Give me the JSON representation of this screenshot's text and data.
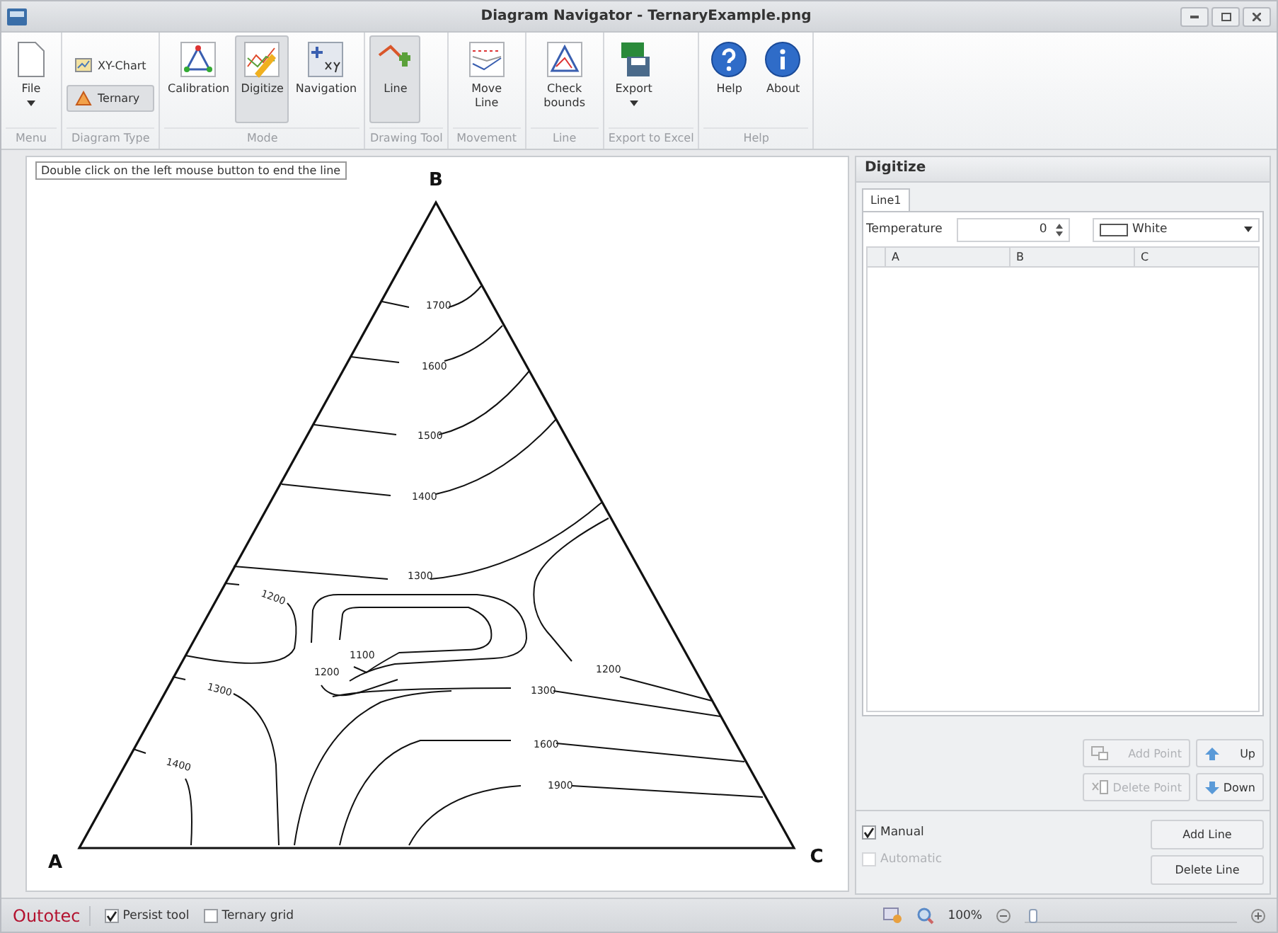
{
  "window": {
    "title": "Diagram Navigator - TernaryExample.png"
  },
  "ribbon": [
    {
      "label": "Menu",
      "kind": "large",
      "buttons": [
        {
          "label": "File",
          "selected": false,
          "dropdown": true
        }
      ]
    },
    {
      "label": "Diagram Type",
      "kind": "small",
      "buttons": [
        {
          "label": "XY-Chart",
          "selected": false
        },
        {
          "label": "Ternary",
          "selected": true
        }
      ]
    },
    {
      "label": "Mode",
      "kind": "large",
      "buttons": [
        {
          "label": "Calibration",
          "selected": false
        },
        {
          "label": "Digitize",
          "selected": true
        },
        {
          "label": "Navigation",
          "selected": false
        }
      ]
    },
    {
      "label": "Drawing Tool",
      "kind": "large",
      "buttons": [
        {
          "label": "Line",
          "selected": true
        }
      ]
    },
    {
      "label": "Movement",
      "kind": "large",
      "buttons": [
        {
          "label": "Move Line",
          "selected": false
        }
      ]
    },
    {
      "label": "Line",
      "kind": "large",
      "buttons": [
        {
          "label": "Check bounds",
          "selected": false
        }
      ]
    },
    {
      "label": "Export to Excel",
      "kind": "large",
      "buttons": [
        {
          "label": "Export",
          "selected": false,
          "dropdown": true
        }
      ]
    },
    {
      "label": "Help",
      "kind": "large",
      "buttons": [
        {
          "label": "Help",
          "selected": false
        },
        {
          "label": "About",
          "selected": false
        }
      ]
    }
  ],
  "canvas": {
    "hint": "Double click on the left mouse button to end the line",
    "vertices": [
      "B",
      "A",
      "C"
    ],
    "contour_labels": [
      "1700",
      "1600",
      "1500",
      "1400",
      "1300",
      "1200",
      "1100",
      "1200",
      "1200",
      "1300",
      "1300",
      "1600",
      "1900",
      "1400"
    ]
  },
  "panel": {
    "title": "Digitize",
    "tabs": [
      {
        "label": "Line1",
        "selected": true
      }
    ],
    "temperature": {
      "label": "Temperature",
      "value": "0"
    },
    "line_style": "White",
    "table": {
      "columns": [
        "A",
        "B",
        "C"
      ]
    },
    "point_buttons": [
      {
        "label": "Add Point",
        "disabled": true
      },
      {
        "label": "Up",
        "disabled": false
      },
      {
        "label": "Delete Point",
        "disabled": true
      },
      {
        "label": "Down",
        "disabled": false
      }
    ],
    "modes": [
      {
        "label": "Manual",
        "checked": true,
        "disabled": false
      },
      {
        "label": "Automatic",
        "checked": false,
        "disabled": true
      }
    ],
    "line_buttons": [
      "Add Line",
      "Delete Line"
    ]
  },
  "status_bar": {
    "logo": "Outotec",
    "options": [
      {
        "label": "Persist tool",
        "checked": true
      },
      {
        "label": "Ternary grid",
        "checked": false
      }
    ],
    "zoom": "100%",
    "zoom_slider": {
      "level": 0.02
    }
  }
}
